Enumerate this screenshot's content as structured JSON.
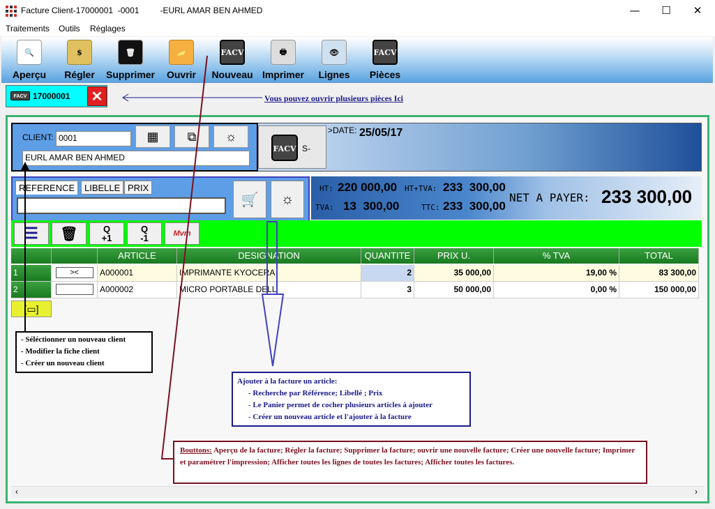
{
  "window": {
    "title": "Facture Client-17000001  -0001         -EURL AMAR BEN AHMED",
    "minimize": "—",
    "maximize": "☐",
    "close": "✕"
  },
  "menu": [
    "Traitements",
    "Outils",
    "Réglages"
  ],
  "toolbar": [
    {
      "label": "Aperçu",
      "icon": "preview-icon"
    },
    {
      "label": "Régler",
      "icon": "coins-icon"
    },
    {
      "label": "Supprimer",
      "icon": "trash-icon"
    },
    {
      "label": "Ouvrir",
      "icon": "folder-icon"
    },
    {
      "label": "Nouveau",
      "icon": "facv-icon"
    },
    {
      "label": "Imprimer",
      "icon": "printer-icon"
    },
    {
      "label": "Lignes",
      "icon": "eye-icon"
    },
    {
      "label": "Pièces",
      "icon": "facv-icon"
    }
  ],
  "doc_tab": {
    "badge": "FACV",
    "number": "17000001",
    "close": "✕"
  },
  "open_hint": "Vous pouvez ouvrir plusieurs pièces Ici",
  "client": {
    "label": "CLIENT:",
    "code": "0001",
    "name": "EURL AMAR BEN AHMED"
  },
  "facv": {
    "badge": "FACV",
    "suffix": "S-"
  },
  "date": {
    "label": ">DATE:",
    "value": "25/05/17"
  },
  "search_tabs": [
    "REFERENCE",
    "LIBELLE",
    "PRIX"
  ],
  "totals": {
    "ht_label": "HT:",
    "ht": "220 000,00",
    "httva_label": "HT+TVA:",
    "httva": "233  300,00",
    "tva_label": "TVA:",
    "tva": "13  300,00",
    "ttc_label": "TTC:",
    "ttc": "233  300,00",
    "net_label": "NET A PAYER:",
    "net": "233 300,00"
  },
  "actions": {
    "qplus_top": "Q",
    "qplus_bottom": "+1",
    "qminus_top": "Q",
    "qminus_bottom": "-1",
    "mvm": "Mvm"
  },
  "grid": {
    "headers": [
      "ARTICLE",
      "DESIGNATION",
      "QUANTITE",
      "PRIX U.",
      "% TVA",
      "TOTAL"
    ],
    "rows": [
      {
        "n": "1",
        "article": "A000001",
        "designation": "IMPRIMANTE KYOCERA",
        "qty": "2",
        "price": "35 000,00",
        "tva": "19,00 %",
        "total": "83 300,00"
      },
      {
        "n": "2",
        "article": "A000002",
        "designation": "MICRO PORTABLE DELL",
        "qty": "3",
        "price": "50 000,00",
        "tva": "0,00 %",
        "total": "150 000,00"
      }
    ]
  },
  "notes": {
    "client": [
      "- Séléctionner un nouveau client",
      "- Modifier la fiche client",
      "- Créer un nouveau client"
    ],
    "article_title": "Ajouter à la facture un article:",
    "article": [
      "- Recherche par Référence; Libellé ; Prix",
      "- Le Panier permet de cocher plusieurs articles à ajouter",
      "- Créer un nouveau article et l'ajouter à la facture"
    ],
    "buttons_title": "Bouttons:",
    "buttons_text": " Aperçu de la facture; Régler la facture; Supprimer la facture; ouvrir une nouvelle facture; Créer une nouvelle facture; Imprimer et paramétrer l'impression; Afficher toutes les lignes de toutes les factures;    Afficher toutes les factures."
  },
  "colors": {
    "accent_green": "#00ff00",
    "client_blue": "#5e9ee6",
    "note_red": "#7a1020",
    "note_blue": "#1a1a8c"
  }
}
